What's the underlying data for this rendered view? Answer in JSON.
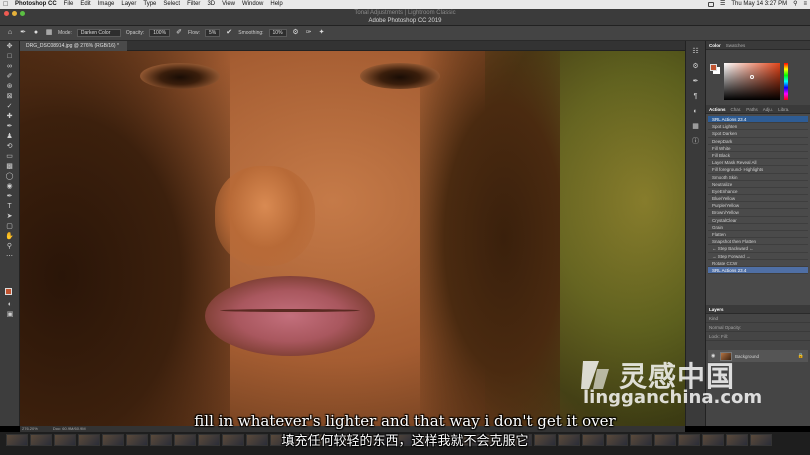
{
  "menubar": {
    "app": "Photoshop CC",
    "items": [
      "File",
      "Edit",
      "Image",
      "Layer",
      "Type",
      "Select",
      "Filter",
      "3D",
      "View",
      "Window",
      "Help"
    ],
    "clock": "Thu May 14  3:27 PM"
  },
  "titlebar": {
    "subtitle": "Tonal Adjustments | Lightroom Classic",
    "title": "Adobe Photoshop CC 2019"
  },
  "options": {
    "mode_label": "Mode:",
    "mode_value": "Darken Color",
    "opacity_label": "Opacity:",
    "opacity_value": "100%",
    "flow_label": "Flow:",
    "flow_value": "5%",
    "smoothing_label": "Smoothing:",
    "smoothing_value": "10%"
  },
  "document": {
    "tab_label": "DRG_DSC08914.jpg @ 276% (RGB/16) *",
    "zoom": "276.20%",
    "doc_size": "Doc: 60.9M/60.9M"
  },
  "panels": {
    "color_tabs": [
      "Color",
      "Swatches"
    ],
    "color_fg": "#c0532f",
    "action_tabs": [
      "Actions",
      "Char.",
      "Paths",
      "Adju.",
      "Libra."
    ],
    "actions": [
      "SRL Actions 23.4",
      "Spot Lighten",
      "Spot Darken",
      "DeepDark",
      "Fill White",
      "Fill Black",
      "Layer Mask Reveal All",
      "Fill foreground- Highlights",
      "Smooth Skin",
      "Neutralize",
      "EyeEnhance",
      "Blue/Yellow",
      "Purple/Yellow",
      "Brown/Yellow",
      "CrystalClear",
      "Grain",
      "Flatten",
      "Snapshot then Flatten",
      "← Step Backward ←",
      "→ Step Forward →",
      "Rotate CCW",
      "SRL Actions 23.4"
    ],
    "layers_title": "Layers",
    "layers_rows": [
      "Kind",
      "Normal            Opacity:",
      "Lock:              Fill:"
    ],
    "layer_name": "Background"
  },
  "watermark": {
    "cn": "灵感中国",
    "url": "lingganchina.com"
  },
  "subtitles": {
    "en": "fill in whatever's lighter and that way i don't get it over",
    "cn": "填充任何较轻的东西，这样我就不会克服它"
  }
}
